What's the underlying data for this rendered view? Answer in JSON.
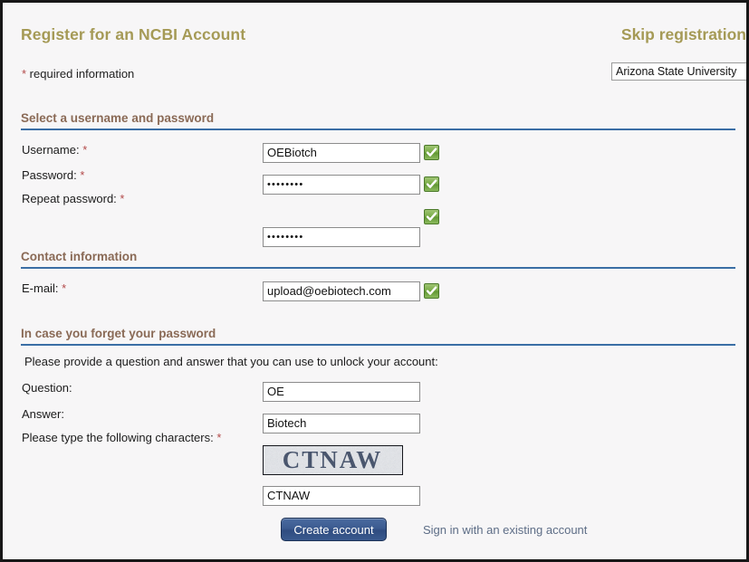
{
  "header": {
    "title": "Register for an NCBI Account",
    "skip_label": "Skip registration",
    "required_star": "*",
    "required_note": " required information",
    "organization_value": "Arizona State University"
  },
  "sections": {
    "credentials": {
      "heading": "Select a username and password",
      "username_label": "Username:",
      "username_value": "OEBiotch",
      "password_label": "Password:",
      "password_value": "••••••••",
      "repeat_password_label": "Repeat password:",
      "repeat_password_value": "••••••••",
      "star": "*"
    },
    "contact": {
      "heading": "Contact information",
      "email_label": "E-mail:",
      "email_value": "upload@oebiotech.com",
      "star": "*"
    },
    "recovery": {
      "heading": "In case you forget your password",
      "instruction": "Please provide a question and answer that you can use to unlock your account:",
      "question_label": "Question:",
      "question_value": "OE",
      "answer_label": "Answer:",
      "answer_value": "Biotech",
      "captcha_label": "Please type the following characters:",
      "captcha_image_text": "CTNAW",
      "captcha_input_value": "CTNAW",
      "star": "*"
    }
  },
  "footer": {
    "create_label": "Create account",
    "signin_label": "Sign in with an existing account"
  },
  "colors": {
    "title": "#a59a56",
    "section_heading": "#8a6a56",
    "rule": "#3a6ea5",
    "required_star": "#b34a4a",
    "button": "#3c5b90",
    "link": "#5d6d86",
    "valid_check": "#79ab46"
  }
}
